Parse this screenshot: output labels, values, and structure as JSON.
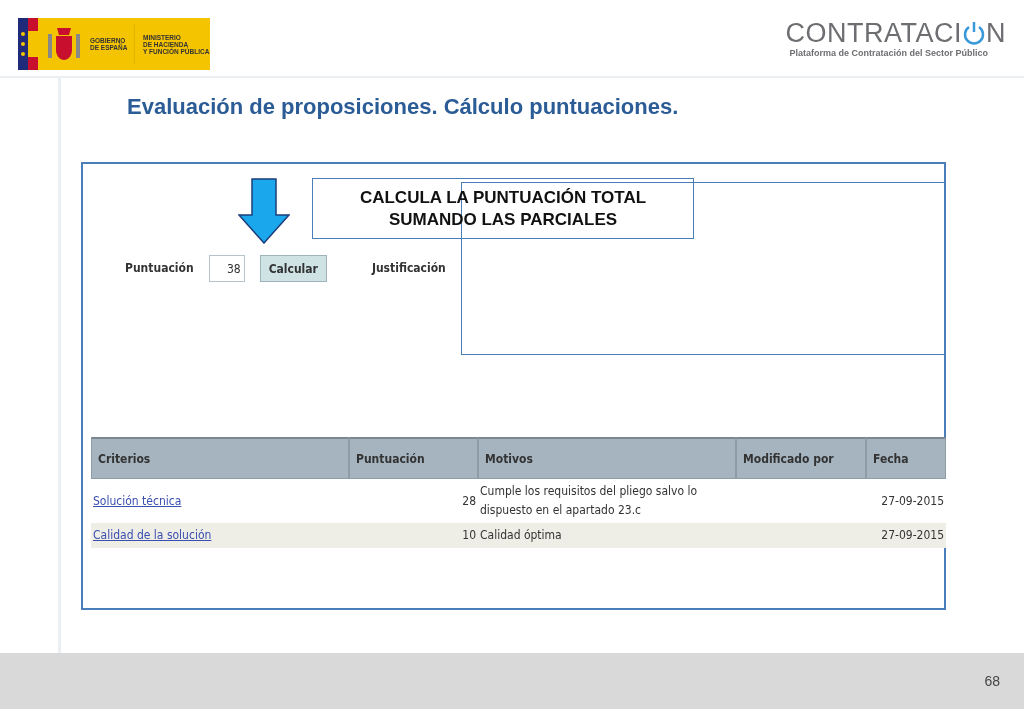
{
  "header": {
    "gov_logo": {
      "line_1": "GOBIERNO",
      "line_2": "DE ESPAÑA",
      "ministry_1": "MINISTERIO",
      "ministry_2": "DE HACIENDA",
      "ministry_3": "Y FUNCIÓN PÚBLICA"
    },
    "brand": {
      "word_start": "CONTRATACI",
      "word_end": "N",
      "subtitle": "Plataforma de Contratación del Sector Público"
    }
  },
  "title": "Evaluación de proposiciones. Cálculo puntuaciones.",
  "callout": {
    "line_1": "CALCULA LA PUNTUACIÓN TOTAL",
    "line_2": "SUMANDO LAS PARCIALES"
  },
  "form": {
    "score_label": "Puntuación",
    "score_value": "38",
    "calc_button": "Calcular",
    "justification_label": "Justificación"
  },
  "table": {
    "columns": [
      "Criterios",
      "Puntuación",
      "Motivos",
      "Modificado por",
      "Fecha"
    ],
    "rows": [
      {
        "criterion": "Solución técnica",
        "score": "28",
        "reason": "Cumple los requisitos del pliego salvo lo dispuesto en el apartado 23.c",
        "date": "27-09-2015"
      },
      {
        "criterion": "Calidad de la solución",
        "score": "10",
        "reason": "Calidad óptima",
        "date": "27-09-2015"
      }
    ]
  },
  "footer": {
    "page_number": "68"
  }
}
